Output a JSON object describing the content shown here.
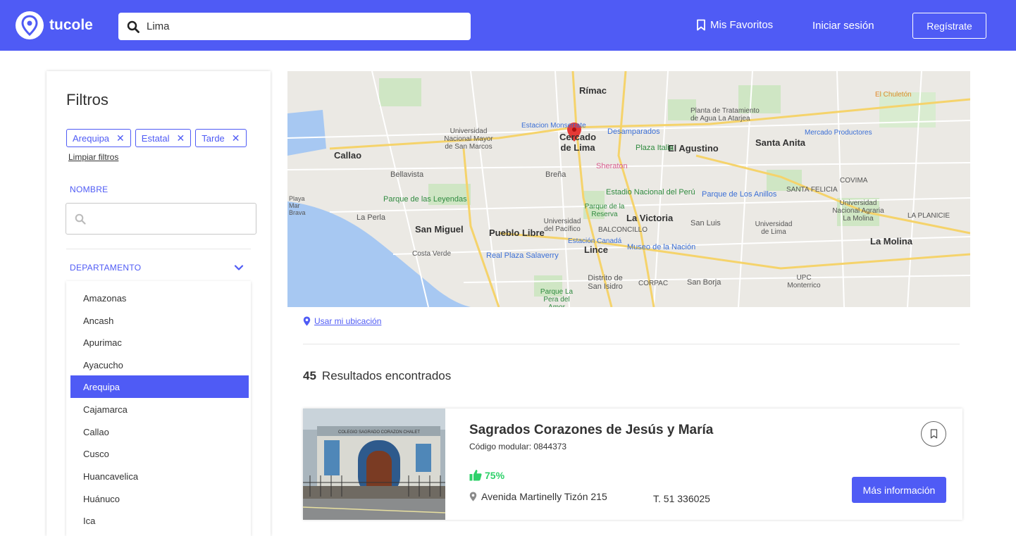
{
  "header": {
    "logo_text": "tucole",
    "search_value": "Lima",
    "favorites_label": "Mis Favoritos",
    "login_label": "Iniciar sesión",
    "register_label": "Regístrate"
  },
  "colors": {
    "primary": "#4f5bf5",
    "rating_green": "#2fd16a"
  },
  "filters": {
    "title": "Filtros",
    "chips": [
      {
        "label": "Arequipa"
      },
      {
        "label": "Estatal"
      },
      {
        "label": "Tarde"
      }
    ],
    "clear_label": "Limpiar filtros",
    "name_label": "NOMBRE",
    "name_placeholder": "",
    "department_label": "DEPARTAMENTO",
    "departments": [
      "Amazonas",
      "Ancash",
      "Apurimac",
      "Ayacucho",
      "Arequipa",
      "Cajamarca",
      "Callao",
      "Cusco",
      "Huancavelica",
      "Huánuco",
      "Ica"
    ],
    "selected_department": "Arequipa"
  },
  "map": {
    "labels": [
      "Rímac",
      "Cercado de Lima",
      "Callao",
      "El Agustino",
      "Santa Anita",
      "Bellavista",
      "Breña",
      "Universidad Nacional Mayor de San Marcos",
      "Desamparados",
      "Plaza Italia",
      "Sheraton",
      "Estadio Nacional del Perú",
      "Parque de Los Anillos",
      "SANTA FELICIA",
      "COVIMA",
      "Universidad Nacional Agraria La Molina",
      "Parque de las Leyendas",
      "La Perla",
      "San Miguel",
      "Pueblo Libre",
      "Universidad del Pacífico",
      "La Victoria",
      "Parque de la Reserva",
      "BALCONCILLO",
      "San Luis",
      "Universidad de Lima",
      "La Molina",
      "Lince",
      "Estación Canadá",
      "Museo de la Nación",
      "Real Plaza Salaverry",
      "Costa Verde",
      "Distrito de San Isidro",
      "CORPAC",
      "San Borja",
      "UPC Monterrico",
      "Parque La Pera del Amor",
      "Playa Mar Brava",
      "Estacion Monserrate",
      "Planta de Tratamiento de Agua La Atarjea",
      "Mercado Productores",
      "El Chuletón",
      "LA PLANICIE"
    ],
    "use_location_label": "Usar mi ubicación"
  },
  "results": {
    "count": "45",
    "label": "Resultados encontrados"
  },
  "school": {
    "name": "Sagrados Corazones de Jesús y María",
    "code": "Código modular: 0844373",
    "rating": "75%",
    "address": "Avenida Martinelly Tizón 215",
    "phone": "T. 51 336025",
    "more_label": "Más información",
    "sign_text": "COLEGIO SAGRADO CORAZON CHALET"
  }
}
